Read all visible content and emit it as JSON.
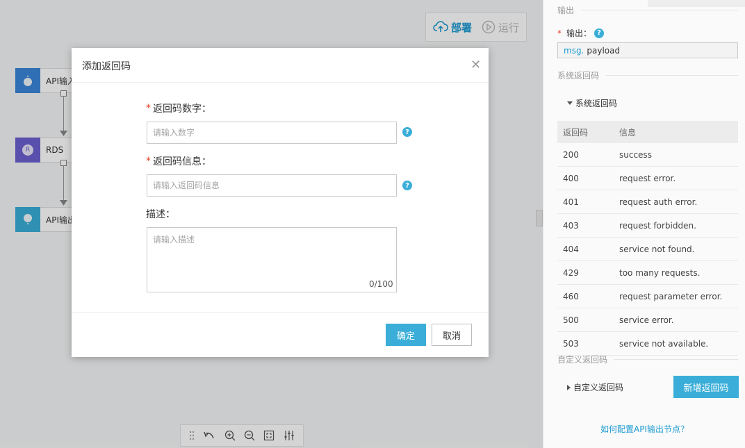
{
  "canvas": {
    "toolbar": {
      "deploy_label": "部署",
      "run_label": "运行"
    },
    "nodes": [
      {
        "label": "API输入",
        "color": "#3a86d8"
      },
      {
        "label": "RDS",
        "color": "#6b5fcf"
      },
      {
        "label": "API输出",
        "color": "#3aaed8"
      }
    ],
    "rds_badge": "R"
  },
  "panel": {
    "output_section": "输出",
    "output_label": "输出：",
    "output_prefix": "msg.",
    "output_value": "payload",
    "system_section": "系统返回码",
    "system_toggle": "系统返回码",
    "table_headers": [
      "返回码",
      "信息"
    ],
    "table_rows": [
      [
        "200",
        "success"
      ],
      [
        "400",
        "request error."
      ],
      [
        "401",
        "request auth error."
      ],
      [
        "403",
        "request forbidden."
      ],
      [
        "404",
        "service not found."
      ],
      [
        "429",
        "too many requests."
      ],
      [
        "460",
        "request parameter error."
      ],
      [
        "500",
        "service error."
      ],
      [
        "503",
        "service not available."
      ]
    ],
    "custom_section": "自定义返回码",
    "custom_toggle": "自定义返回码",
    "add_button": "新增返回码",
    "help_link": "如何配置API输出节点？"
  },
  "modal": {
    "title": "添加返回码",
    "field_code_label": "返回码数字：",
    "field_code_placeholder": "请输入数字",
    "field_info_label": "返回码信息：",
    "field_info_placeholder": "请输入返回码信息",
    "field_desc_label": "描述：",
    "field_desc_placeholder": "请输入描述",
    "desc_counter": "0/100",
    "ok_label": "确定",
    "cancel_label": "取消",
    "required_mark": "*",
    "help_mark": "?"
  },
  "colors": {
    "accent": "#3aaed8",
    "link": "#1c9bd1",
    "required": "#e0442c"
  }
}
